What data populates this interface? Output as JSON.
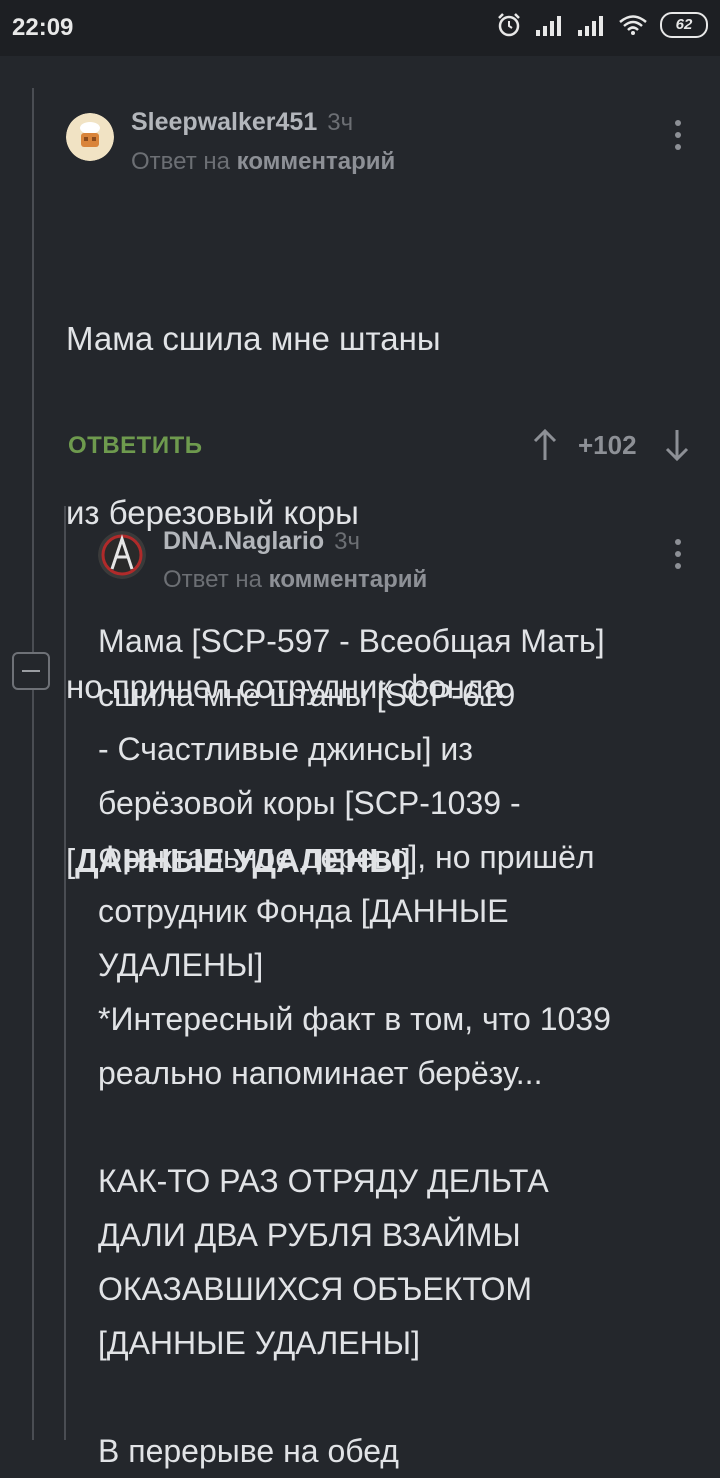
{
  "status_bar": {
    "time": "22:09",
    "battery": "62",
    "icons": [
      "alarm-icon",
      "signal-icon",
      "signal-icon",
      "wifi-icon",
      "battery-icon"
    ]
  },
  "comments": [
    {
      "username": "Sleepwalker451",
      "age": "3ч",
      "reply_prefix": "Ответ на",
      "reply_target": "комментарий",
      "body_lines": [
        "Мама сшила мне штаны",
        "из березовый коры",
        "но пришел сотрудник фонда"
      ],
      "body_bracket_open": "[",
      "body_bold": "ДАННЫЕ УДАЛЕНЫ",
      "body_bracket_close": "]",
      "reply_label": "ОТВЕТИТЬ",
      "score": "+102"
    },
    {
      "username": "DNA.Naglario",
      "age": "3ч",
      "reply_prefix": "Ответ на",
      "reply_target": "комментарий",
      "body": "Мама [SCP-597 - Всеобщая Мать]\nсшила мне штаны [SCP-619\n- Счастливые джинсы] из\nберёзовой коры [SCP-1039 -\nФрактальное дерево], но пришёл\nсотрудник Фонда [ДАННЫЕ\nУДАЛЕНЫ]\n*Интересный факт в том, что 1039\nреально напоминает берёзу...\n\nКАК-ТО РАЗ ОТРЯДУ ДЕЛЬТА\nДАЛИ ДВА РУБЛЯ ВЗАЙМЫ\nОКАЗАВШИХСЯ ОБЪЕКТОМ\n[ДАННЫЕ УДАЛЕНЫ]\n\nВ перерыве на обед"
    }
  ]
}
